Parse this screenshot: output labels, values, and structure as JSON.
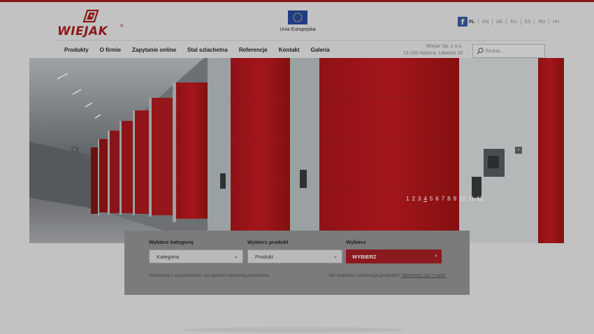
{
  "brand": {
    "name": "WIEJAK",
    "reg": "®",
    "color": "#8a1a1d"
  },
  "eu": {
    "label": "Unia Europejska"
  },
  "social": {
    "facebook_icon": "f"
  },
  "languages": [
    "PL",
    "EN",
    "DE",
    "RU",
    "ES",
    "RO",
    "HU"
  ],
  "active_language": "PL",
  "nav": {
    "items": [
      "Produkty",
      "O firmie",
      "Zapytanie online",
      "Stal szlachetna",
      "Referencje",
      "Kontakt",
      "Galeria"
    ]
  },
  "company": {
    "line1": "Wiejak Sp. z o.o.",
    "line2": "13-100 Nidzica, Litewski 16"
  },
  "search": {
    "placeholder": "Szukaj..."
  },
  "hero": {
    "prev_icon": "‹",
    "next_icon": "›",
    "pages": [
      "1",
      "2",
      "3",
      "4",
      "5",
      "6",
      "7",
      "8",
      "9",
      "10",
      "11",
      "12"
    ],
    "active_page": "4"
  },
  "finder": {
    "category_label": "Wybierz kategorię",
    "category_value": "Kategoria",
    "product_label": "Wybierz produkt",
    "product_value": "Produkt",
    "choose_label": "Wybierz",
    "choose_button": "WYBIERZ",
    "hint": "Skorzystaj z wyszukiwarki, lub wybierz kategorię produktów.",
    "missing_text": "Nie znalazłeś szukanego produktu?",
    "missing_link": "Skontaktuj się z nami!"
  }
}
